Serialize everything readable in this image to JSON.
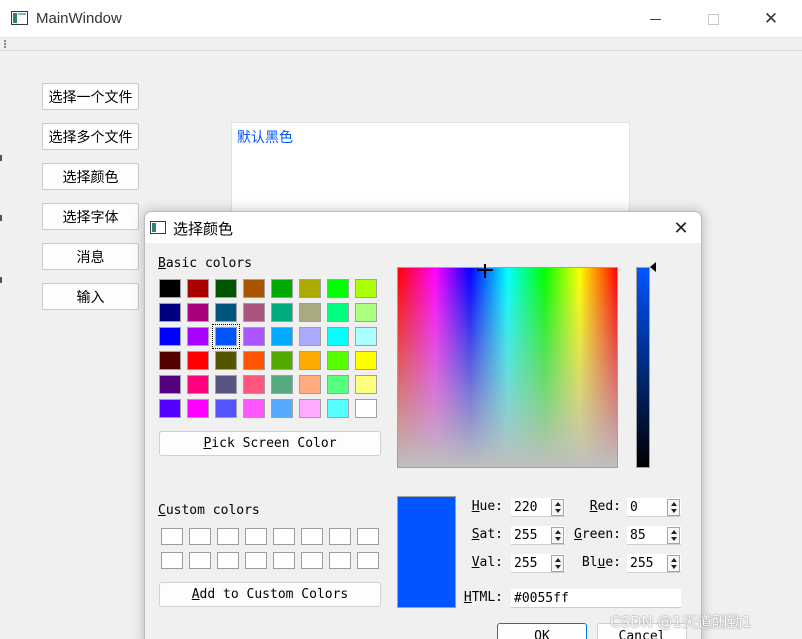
{
  "window": {
    "title": "MainWindow"
  },
  "main": {
    "buttons": [
      {
        "label": "选择一个文件"
      },
      {
        "label": "选择多个文件"
      },
      {
        "label": "选择颜色"
      },
      {
        "label": "选择字体"
      },
      {
        "label": "消息"
      },
      {
        "label": "输入"
      }
    ],
    "text_display": {
      "text": "默认黑色",
      "color": "#0055ff"
    }
  },
  "dialog": {
    "title": "选择颜色",
    "basic_colors": {
      "label_accel": "B",
      "label_rest": "asic colors",
      "swatches": [
        "#000000",
        "#aa0000",
        "#005500",
        "#aa5500",
        "#00aa00",
        "#aaaa00",
        "#00ff00",
        "#aaff00",
        "#000080",
        "#aa007f",
        "#00557f",
        "#aa557f",
        "#00aa7f",
        "#aaaa7f",
        "#00ff7f",
        "#aaff7f",
        "#0000ff",
        "#aa00ff",
        "#0055ff",
        "#aa55ff",
        "#00aaff",
        "#aaaaff",
        "#00ffff",
        "#aaffff",
        "#550000",
        "#ff0000",
        "#555500",
        "#ff5500",
        "#55aa00",
        "#ffaa00",
        "#55ff00",
        "#ffff00",
        "#55007f",
        "#ff007f",
        "#55557f",
        "#ff557f",
        "#55aa7f",
        "#ffaa7f",
        "#55ff7f",
        "#ffff7f",
        "#5500ff",
        "#ff00ff",
        "#5555ff",
        "#ff55ff",
        "#55aaff",
        "#ffaaff",
        "#55ffff",
        "#ffffff"
      ],
      "selected_index": 18
    },
    "pick_screen": {
      "accel": "P",
      "rest": "ick Screen Color"
    },
    "custom_colors": {
      "label_accel": "C",
      "label_rest": "ustom colors",
      "count": 16
    },
    "add_custom": {
      "accel": "A",
      "rest": "dd to Custom Colors"
    },
    "current_color": "#0055ff",
    "fields": {
      "hue": {
        "accel": "H",
        "rest": "ue:",
        "value": "220"
      },
      "sat": {
        "accel": "S",
        "rest": "at:",
        "value": "255"
      },
      "val": {
        "accel": "V",
        "rest": "al:",
        "value": "255"
      },
      "red": {
        "accel": "R",
        "rest": "ed:",
        "value": "0"
      },
      "green": {
        "accel": "G",
        "rest": "reen:",
        "value": "85"
      },
      "blue": {
        "accel": "u",
        "pre": "Bl",
        "rest": "e:",
        "value": "255"
      },
      "html": {
        "accel": "H",
        "rest": "TML:",
        "value": "#0055ff"
      }
    },
    "ok_label": "OK",
    "cancel_label": "Cancel"
  },
  "watermark": "CSDN @1天道酬勤1"
}
